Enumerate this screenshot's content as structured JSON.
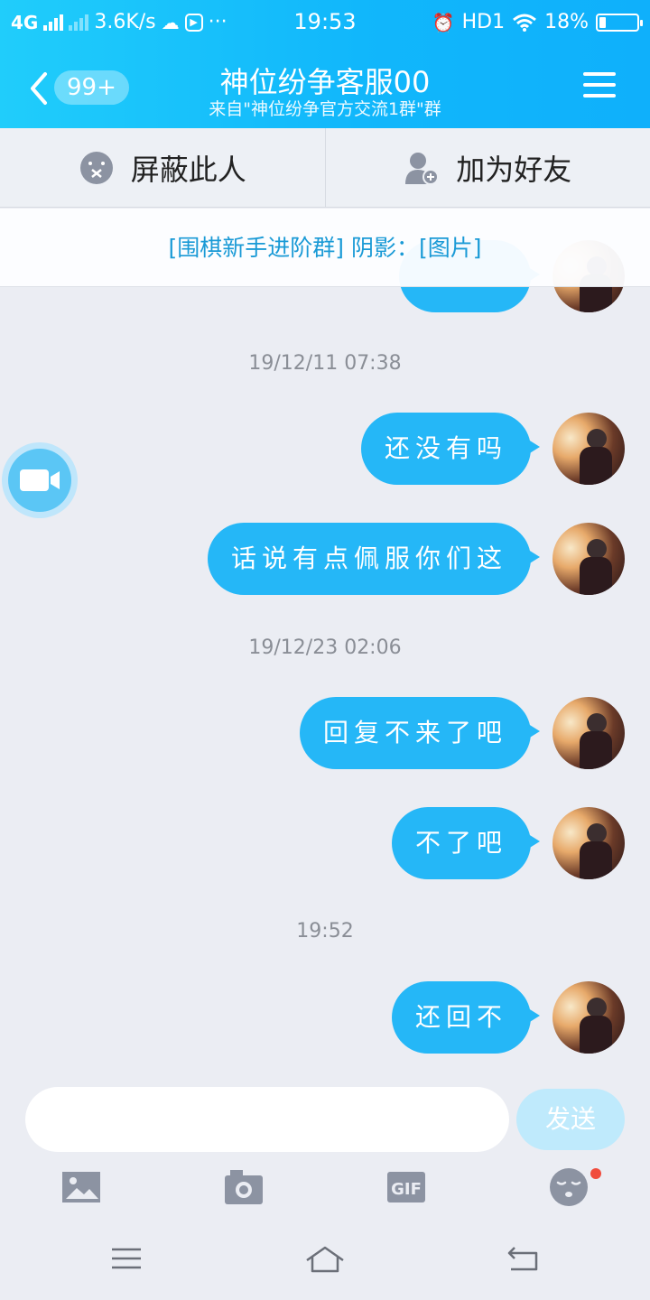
{
  "status_bar": {
    "network": "4G",
    "speed": "3.6K/s",
    "more": "···",
    "time": "19:53",
    "hd": "HD1",
    "battery": "18%",
    "battery_level": 0.18
  },
  "header": {
    "back_badge": "99+",
    "title": "神位纷争客服00",
    "subtitle": "来自\"神位纷争官方交流1群\"群"
  },
  "actions": {
    "block": "屏蔽此人",
    "add_friend": "加为好友"
  },
  "notice": {
    "text": "[围棋新手进阶群] 阴影：[图片]"
  },
  "messages": [
    {
      "type": "time",
      "text": "19/12/11 07:38"
    },
    {
      "type": "msg",
      "text": "还没有吗"
    },
    {
      "type": "msg",
      "text": "话说有点佩服你们这"
    },
    {
      "type": "time",
      "text": "19/12/23 02:06"
    },
    {
      "type": "msg",
      "text": "回复不来了吧"
    },
    {
      "type": "msg",
      "text": "不了吧"
    },
    {
      "type": "time",
      "text": "19:52"
    },
    {
      "type": "msg",
      "text": "还回不"
    }
  ],
  "composer": {
    "input_value": "",
    "send_label": "发送"
  },
  "tools": [
    "image-icon",
    "camera-icon",
    "gif-icon",
    "emoji-icon"
  ],
  "colors": {
    "accent": "#12b7f5",
    "bubble": "#25b7f7",
    "background": "#ebedf3"
  }
}
